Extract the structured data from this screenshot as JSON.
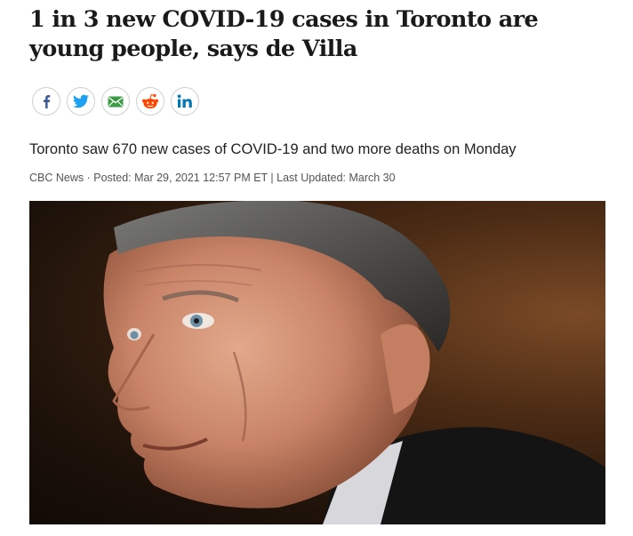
{
  "article": {
    "headline": "1 in 3 new COVID-19 cases in Toronto are young people, says de Villa",
    "dek": "Toronto saw 670 new cases of COVID-19 and two more deaths on Monday",
    "byline": {
      "source": "CBC News",
      "separator": " · ",
      "posted": "Posted: Mar 29, 2021 12:57 PM ET",
      "divider": " | ",
      "updated": "Last Updated: March 30"
    }
  },
  "share": {
    "buttons": [
      {
        "icon": "facebook-icon",
        "color": "#3b5998"
      },
      {
        "icon": "twitter-icon",
        "color": "#1da1f2"
      },
      {
        "icon": "email-icon",
        "color": "#3a9b45"
      },
      {
        "icon": "reddit-icon",
        "color": "#ff4500"
      },
      {
        "icon": "linkedin-icon",
        "color": "#0077b5"
      }
    ]
  },
  "colors": {
    "text": "#1a1a1a",
    "meta": "#555555",
    "border": "#d0d0d0"
  }
}
